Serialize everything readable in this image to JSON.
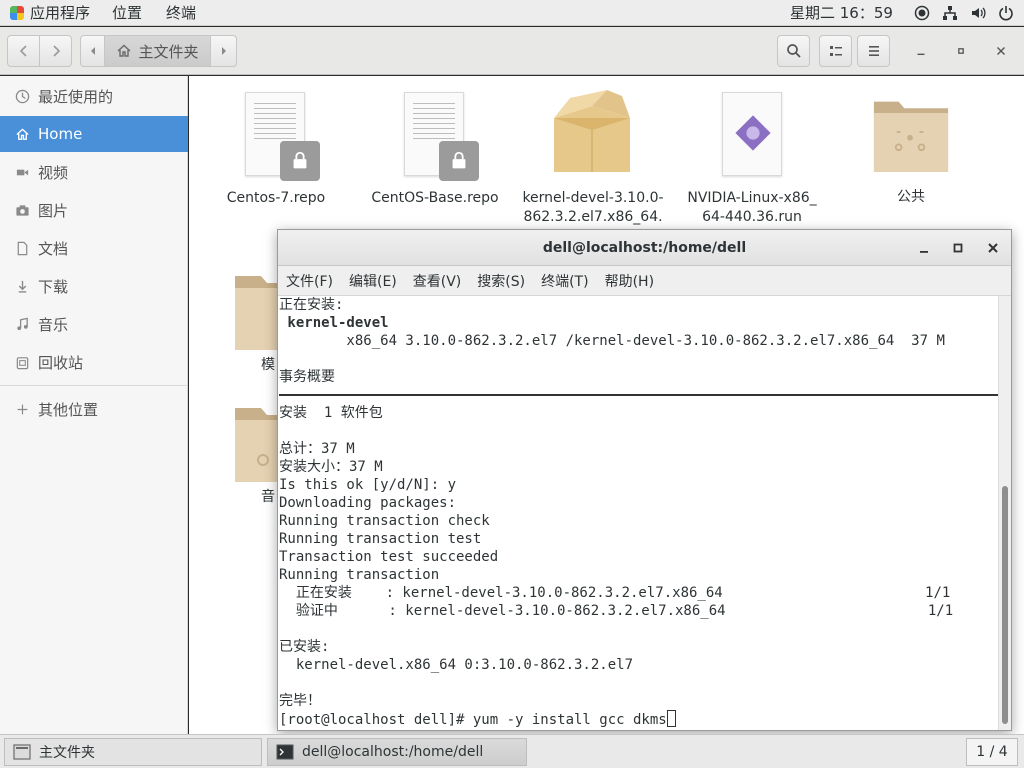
{
  "top_panel": {
    "applications": "应用程序",
    "places": "位置",
    "terminal": "终端",
    "clock": "星期二 16：59"
  },
  "file_manager": {
    "path_home": "主文件夹",
    "sidebar": [
      {
        "label": "最近使用的",
        "icon": "clock-icon"
      },
      {
        "label": "Home",
        "icon": "home-icon"
      },
      {
        "label": "视频",
        "icon": "video-icon"
      },
      {
        "label": "图片",
        "icon": "camera-icon"
      },
      {
        "label": "文档",
        "icon": "document-icon"
      },
      {
        "label": "下载",
        "icon": "download-icon"
      },
      {
        "label": "音乐",
        "icon": "music-icon"
      },
      {
        "label": "回收站",
        "icon": "trash-icon"
      },
      {
        "label": "其他位置",
        "icon": "plus-icon"
      }
    ],
    "files": [
      {
        "name": "Centos-7.repo",
        "type": "locked-text-file"
      },
      {
        "name": "CentOS-Base.repo",
        "type": "locked-text-file"
      },
      {
        "name": "kernel-devel-3.10.0-862.3.2.el7.x86_64.",
        "line1": "kernel-devel-3.10.0-",
        "line2": "862.3.2.el7.x86_64.",
        "type": "package"
      },
      {
        "name": "NVIDIA-Linux-x86_64-440.36.run",
        "line1": "NVIDIA-Linux-x86_",
        "line2": "64-440.36.run",
        "type": "executable"
      },
      {
        "name": "公共",
        "type": "shared-folder"
      }
    ],
    "partial_files": [
      {
        "name": "模",
        "type": "folder"
      },
      {
        "name": "音",
        "type": "music-folder"
      }
    ]
  },
  "terminal": {
    "title": "dell@localhost:/home/dell",
    "menu": [
      "文件(F)",
      "编辑(E)",
      "查看(V)",
      "搜索(S)",
      "终端(T)",
      "帮助(H)"
    ],
    "lines_before_sep": [
      {
        "text": "正在安装:",
        "bold": false
      },
      {
        "text": " kernel-devel",
        "bold": true
      },
      {
        "text": "        x86_64 3.10.0-862.3.2.el7 /kernel-devel-3.10.0-862.3.2.el7.x86_64  37 M",
        "bold": false
      },
      {
        "text": "",
        "bold": false
      },
      {
        "text": "事务概要",
        "bold": false
      }
    ],
    "lines_after_sep": [
      "安装  1 软件包",
      "",
      "总计：37 M",
      "安装大小：37 M",
      "Is this ok [y/d/N]: y",
      "Downloading packages:",
      "Running transaction check",
      "Running transaction test",
      "Transaction test succeeded",
      "Running transaction",
      "  正在安装    : kernel-devel-3.10.0-862.3.2.el7.x86_64                        1/1",
      "  验证中      : kernel-devel-3.10.0-862.3.2.el7.x86_64                        1/1",
      "",
      "已安装:",
      "  kernel-devel.x86_64 0:3.10.0-862.3.2.el7",
      "",
      "完毕！"
    ],
    "prompt": "[root@localhost dell]# yum -y install gcc dkms"
  },
  "taskbar": {
    "tasks": [
      "主文件夹",
      "dell@localhost:/home/dell"
    ],
    "pager": "1 / 4"
  }
}
